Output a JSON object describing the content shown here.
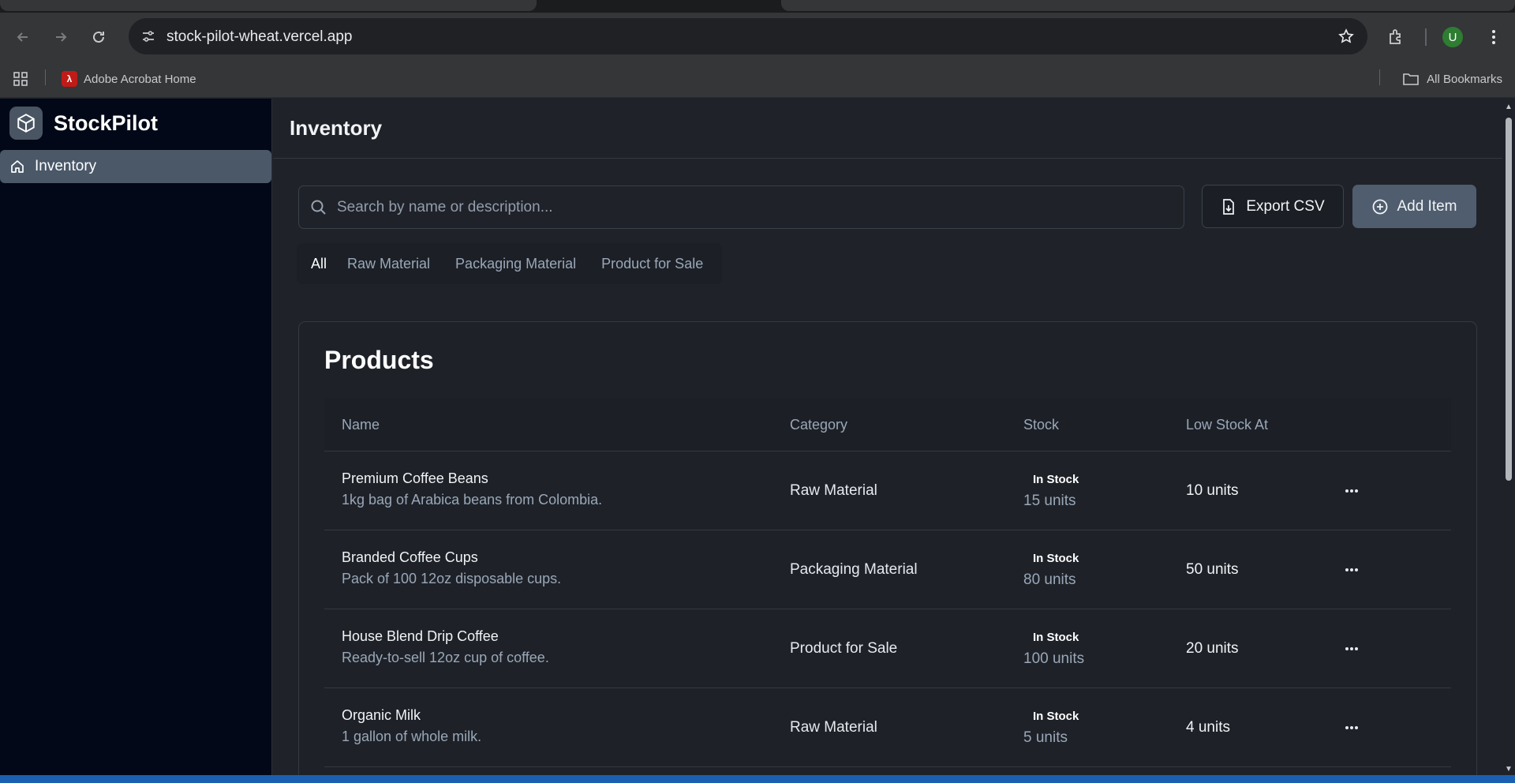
{
  "browser": {
    "url": "stock-pilot-wheat.vercel.app",
    "profile_initial": "U",
    "bookmarks": [
      {
        "label": "Adobe Acrobat Home",
        "icon": "pdf-icon"
      }
    ],
    "all_bookmarks_label": "All Bookmarks"
  },
  "app": {
    "name": "StockPilot",
    "logo_icon": "package-icon",
    "nav": [
      {
        "label": "Inventory",
        "icon": "home-icon",
        "active": true
      }
    ]
  },
  "page": {
    "title": "Inventory",
    "search": {
      "placeholder": "Search by name or description...",
      "value": ""
    },
    "export_label": "Export CSV",
    "add_label": "Add Item",
    "filters": [
      "All",
      "Raw Material",
      "Packaging Material",
      "Product for Sale"
    ],
    "active_filter": "All"
  },
  "products": {
    "title": "Products",
    "columns": [
      "Name",
      "Category",
      "Stock",
      "Low Stock At"
    ],
    "rows": [
      {
        "name": "Premium Coffee Beans",
        "description": "1kg bag of Arabica beans from Colombia.",
        "category": "Raw Material",
        "status": "In Stock",
        "stock": "15 units",
        "low_stock_at": "10 units"
      },
      {
        "name": "Branded Coffee Cups",
        "description": "Pack of 100 12oz disposable cups.",
        "category": "Packaging Material",
        "status": "In Stock",
        "stock": "80 units",
        "low_stock_at": "50 units"
      },
      {
        "name": "House Blend Drip Coffee",
        "description": "Ready-to-sell 12oz cup of coffee.",
        "category": "Product for Sale",
        "status": "In Stock",
        "stock": "100 units",
        "low_stock_at": "20 units"
      },
      {
        "name": "Organic Milk",
        "description": "1 gallon of whole milk.",
        "category": "Raw Material",
        "status": "In Stock",
        "stock": "5 units",
        "low_stock_at": "4 units"
      }
    ]
  },
  "colors": {
    "sidebar_bg": "#020817",
    "main_bg": "#1f2329",
    "active_nav": "#4a5868",
    "primary_button": "#4f5d6e"
  }
}
